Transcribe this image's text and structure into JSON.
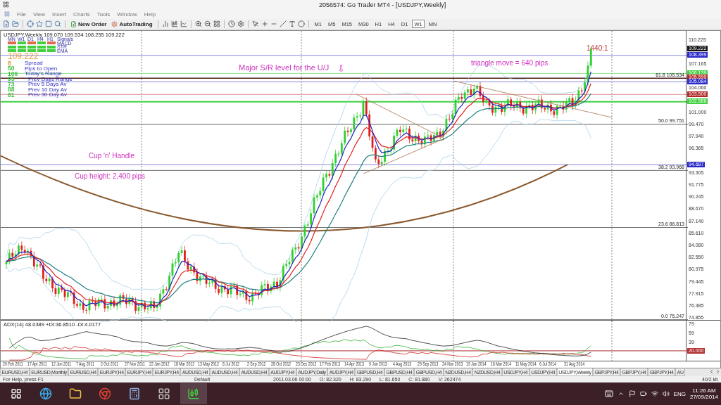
{
  "window": {
    "title": "2056574: Go Trader MT4 - [USDJPY,Weekly]"
  },
  "menu": [
    "File",
    "View",
    "Insert",
    "Charts",
    "Tools",
    "Window",
    "Help"
  ],
  "toolbar": {
    "buttons": [
      {
        "label": "New Order",
        "kind": "order"
      },
      {
        "label": "AutoTrading",
        "kind": "auto"
      }
    ],
    "timeframes": [
      {
        "label": "M1",
        "selected": false
      },
      {
        "label": "M5",
        "selected": false
      },
      {
        "label": "M15",
        "selected": false
      },
      {
        "label": "M30",
        "selected": false
      },
      {
        "label": "H1",
        "selected": false
      },
      {
        "label": "H4",
        "selected": false
      },
      {
        "label": "D1",
        "selected": false
      },
      {
        "label": "W1",
        "selected": true
      },
      {
        "label": "MN",
        "selected": false
      }
    ]
  },
  "chart": {
    "header": "USDJPY,Weekly  109.070 109.534 108.255 109.222",
    "signals": {
      "timeframes": [
        "MN",
        "W1",
        "D1",
        "H4",
        "H1"
      ],
      "title": "Signals",
      "rows": [
        {
          "label": "MACD",
          "cells": [
            {
              "color": "#e06a50"
            },
            {
              "color": "#40d040"
            },
            {
              "color": "#e06a50"
            },
            {
              "color": "#40d040"
            },
            {
              "color": "#e06a50"
            }
          ]
        },
        {
          "label": "STR",
          "cells": [
            {
              "color": "#40d040"
            },
            {
              "color": "#40d040"
            },
            {
              "color": "#40d040"
            },
            {
              "color": "#40d040"
            },
            {
              "color": "#40d040"
            }
          ]
        },
        {
          "label": "EMA",
          "cells": [
            {
              "color": "#40d040"
            },
            {
              "color": "#40d040"
            },
            {
              "color": "#40d040"
            },
            {
              "color": "#40d040"
            },
            {
              "color": "#40d040"
            }
          ]
        }
      ]
    },
    "price": "109.222",
    "stats": [
      {
        "value": "8",
        "label": "Spread",
        "color": "#d89a30"
      },
      {
        "value": "50",
        "label": "Pips to Open",
        "color": "#40c040"
      },
      {
        "value": "106",
        "label": "Today's Range",
        "color": "#40c040"
      },
      {
        "value": "95",
        "label": "Prev Days Range",
        "color": "#40c040"
      },
      {
        "value": "73",
        "label": "Prev 5 Days Av",
        "color": "#40c040"
      },
      {
        "value": "88",
        "label": "Prev 10 Day Av",
        "color": "#40c040"
      },
      {
        "value": "81",
        "label": "Prev 30 Day Av",
        "color": "#40c040"
      }
    ],
    "annotations": [
      {
        "text": "Major S/R level for the U/J",
        "kind": "note"
      },
      {
        "text": "⇩",
        "kind": "arrow"
      },
      {
        "text": "triangle move = 640 pips",
        "kind": "note"
      },
      {
        "text": "1440:1",
        "kind": "ratio"
      },
      {
        "text": "Cup 'n' Handle",
        "kind": "note"
      },
      {
        "text": "Cup height: 2,400 pips",
        "kind": "note"
      }
    ],
    "fib_levels": [
      "61.8 105.534",
      "50.0 99.751",
      "38.2 93.968",
      "23.6 86.813",
      "0.0 75.247"
    ],
    "price_axis": [
      "110.225",
      "107.165",
      "104.060",
      "101.000",
      "99.470",
      "97.940",
      "96.365",
      "93.305",
      "91.775",
      "90.245",
      "88.670",
      "87.140",
      "85.610",
      "84.080",
      "82.550",
      "80.975",
      "79.445",
      "77.915",
      "76.385",
      "74.855"
    ],
    "price_tags": [
      {
        "text": "109.222",
        "color": "#101010"
      },
      {
        "text": "108.399",
        "color": "#2828c8"
      },
      {
        "text": "106.139",
        "color": "#40d040"
      },
      {
        "text": "105.599",
        "color": "#b02828"
      },
      {
        "text": "105.084",
        "color": "#2828c8"
      },
      {
        "text": "103.500",
        "color": "#b02828"
      },
      {
        "text": "102.586",
        "color": "#40d040"
      },
      {
        "text": "94.687",
        "color": "#2828c8"
      }
    ],
    "indicator": {
      "title": "ADX(14) 48.0389 +DI:36.8510 -DI:4.0177",
      "axis": [
        "79",
        "59",
        "39"
      ],
      "tag": "20.000"
    },
    "date_axis": [
      "20 Feb 2011",
      "17 Apr 2011",
      "12 Jun 2011",
      "7 Aug 2011",
      "2 Oct 2011",
      "27 Nov 2011",
      "22 Jan 2012",
      "18 Mar 2012",
      "13 May 2012",
      "8 Jul 2012",
      "2 Sep 2012",
      "28 Oct 2012",
      "23 Dec 2012",
      "17 Feb 2013",
      "14 Apr 2013",
      "9 Jun 2013",
      "4 Aug 2013",
      "29 Sep 2013",
      "24 Nov 2013",
      "19 Jan 2014",
      "16 Mar 2014",
      "11 May 2014",
      "6 Jul 2014",
      "31 Aug 2014"
    ]
  },
  "tabs": [
    {
      "label": "EURUSD,H4",
      "selected": false
    },
    {
      "label": "EURUSD,Monthly",
      "selected": false
    },
    {
      "label": "EURUSD,H4",
      "selected": false
    },
    {
      "label": "EURJPY,H4",
      "selected": false
    },
    {
      "label": "EURJPY,H4",
      "selected": false
    },
    {
      "label": "EURJPY,H4",
      "selected": false
    },
    {
      "label": "AUDUSD,H4",
      "selected": false
    },
    {
      "label": "AUDUSD,H4",
      "selected": false
    },
    {
      "label": "AUDUSD,H4",
      "selected": false
    },
    {
      "label": "AUDJPY,H4",
      "selected": false
    },
    {
      "label": "AUDJPY,Daily",
      "selected": false
    },
    {
      "label": "AUDJPY,H4",
      "selected": false
    },
    {
      "label": "GBPUSD,H4",
      "selected": false
    },
    {
      "label": "GBPUSD,H4",
      "selected": false
    },
    {
      "label": "GBPUSD,H4",
      "selected": false
    },
    {
      "label": "NZDUSD,H4",
      "selected": false
    },
    {
      "label": "NZDUSD,H4",
      "selected": false
    },
    {
      "label": "USDJPY,H4",
      "selected": false
    },
    {
      "label": "USDJPY,H4",
      "selected": false
    },
    {
      "label": "USDJPY,Weekly",
      "selected": true
    },
    {
      "label": "GBPJPY,H4",
      "selected": false
    },
    {
      "label": "GBPJPY,H4",
      "selected": false
    },
    {
      "label": "GBPJPY,H4",
      "selected": false
    },
    {
      "label": "AU",
      "selected": false
    }
  ],
  "status_bar": {
    "help": "For Help, press F1",
    "profile": "Default",
    "time": "2011.03.06 00:00",
    "open": "O: 82.320",
    "high": "H: 83.290",
    "low": "L: 81.650",
    "close": "C: 81.880",
    "volume": "V: 262474",
    "traffic": "40/2 kb"
  },
  "taskbar": {
    "language": "ENG",
    "time": "11:26 AM",
    "date": "27/09/2014"
  }
}
